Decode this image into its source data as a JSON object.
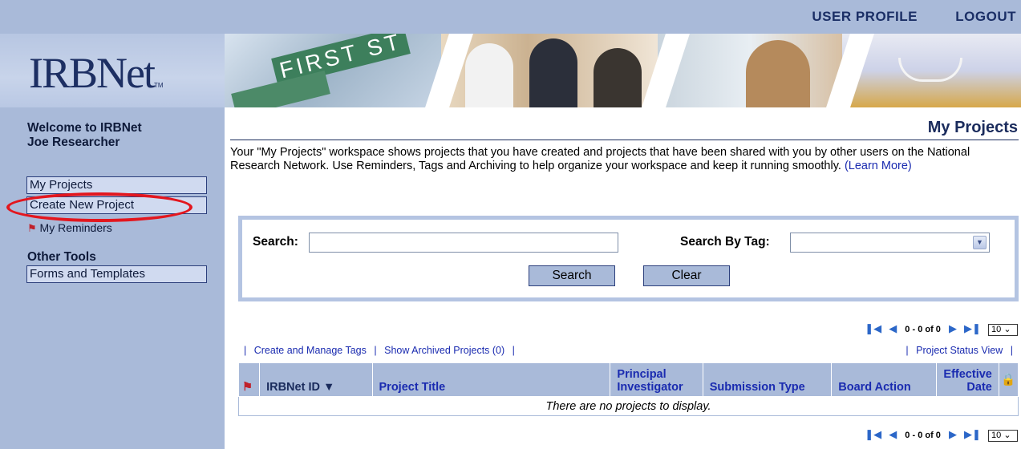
{
  "header": {
    "user_profile": "USER PROFILE",
    "logout": "LOGOUT",
    "logo_text": "IRBNet",
    "logo_tm": "TM",
    "banner_sign": "FIRST ST"
  },
  "sidebar": {
    "welcome_line1": "Welcome to IRBNet",
    "welcome_line2": "Joe Researcher",
    "items": [
      {
        "label": "My Projects"
      },
      {
        "label": "Create New Project"
      }
    ],
    "reminders": "My Reminders",
    "other_tools_heading": "Other Tools",
    "other_tools": [
      {
        "label": "Forms and Templates"
      }
    ]
  },
  "main": {
    "title": "My Projects",
    "intro": "Your \"My Projects\" workspace shows projects that you have created and projects that have been shared with you by other users on the National Research Network. Use Reminders, Tags and Archiving to help organize your workspace and keep it running smoothly.",
    "learn_more": "(Learn More)",
    "search": {
      "label": "Search:",
      "value": "",
      "tag_label": "Search By Tag:",
      "tag_value": "",
      "search_button": "Search",
      "clear_button": "Clear"
    },
    "pager": {
      "range": "0 - 0 of 0",
      "page_size": "10"
    },
    "links": {
      "manage_tags": "Create and Manage Tags",
      "archived": "Show Archived Projects (0)",
      "status_view": "Project Status View"
    },
    "table": {
      "columns": [
        "IRBNet ID",
        "Project Title",
        "Principal Investigator",
        "Submission Type",
        "Board Action",
        "Effective Date"
      ],
      "empty_message": "There are no projects to display."
    }
  },
  "colors": {
    "sidebar_bg": "#a9bad9",
    "nav_button_bg": "#d0daf0",
    "highlight_circle": "#e3161e",
    "link_blue": "#1a2bb0",
    "title_navy": "#1a2b5c"
  },
  "icons": [
    "flag-icon",
    "sort-down-icon",
    "lock-icon",
    "first-page-icon",
    "prev-page-icon",
    "next-page-icon",
    "last-page-icon",
    "dropdown-arrow-icon"
  ]
}
